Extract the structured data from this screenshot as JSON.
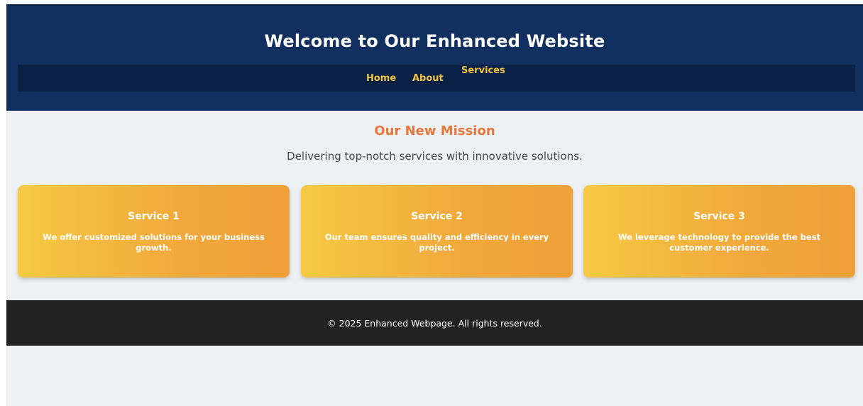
{
  "header": {
    "title": "Welcome to Our Enhanced Website",
    "nav": [
      {
        "label": "Home"
      },
      {
        "label": "About"
      },
      {
        "label": "Services"
      }
    ]
  },
  "mission": {
    "title": "Our New Mission",
    "text": "Delivering top-notch services with innovative solutions."
  },
  "services": [
    {
      "title": "Service 1",
      "text": "We offer customized solutions for your business growth."
    },
    {
      "title": "Service 2",
      "text": "Our team ensures quality and efficiency in every project."
    },
    {
      "title": "Service 3",
      "text": "We leverage technology to provide the best customer experience."
    }
  ],
  "footer": {
    "text": "© 2025 Enhanced Webpage. All rights reserved."
  },
  "colors": {
    "header_bg": "#11305f",
    "nav_bg": "#0a2146",
    "nav_link": "#f2c341",
    "accent": "#e8773a",
    "card_gradient_start": "#f6c944",
    "card_gradient_end": "#f0a039",
    "footer_bg": "#222222",
    "page_bg": "#eef1f3"
  }
}
